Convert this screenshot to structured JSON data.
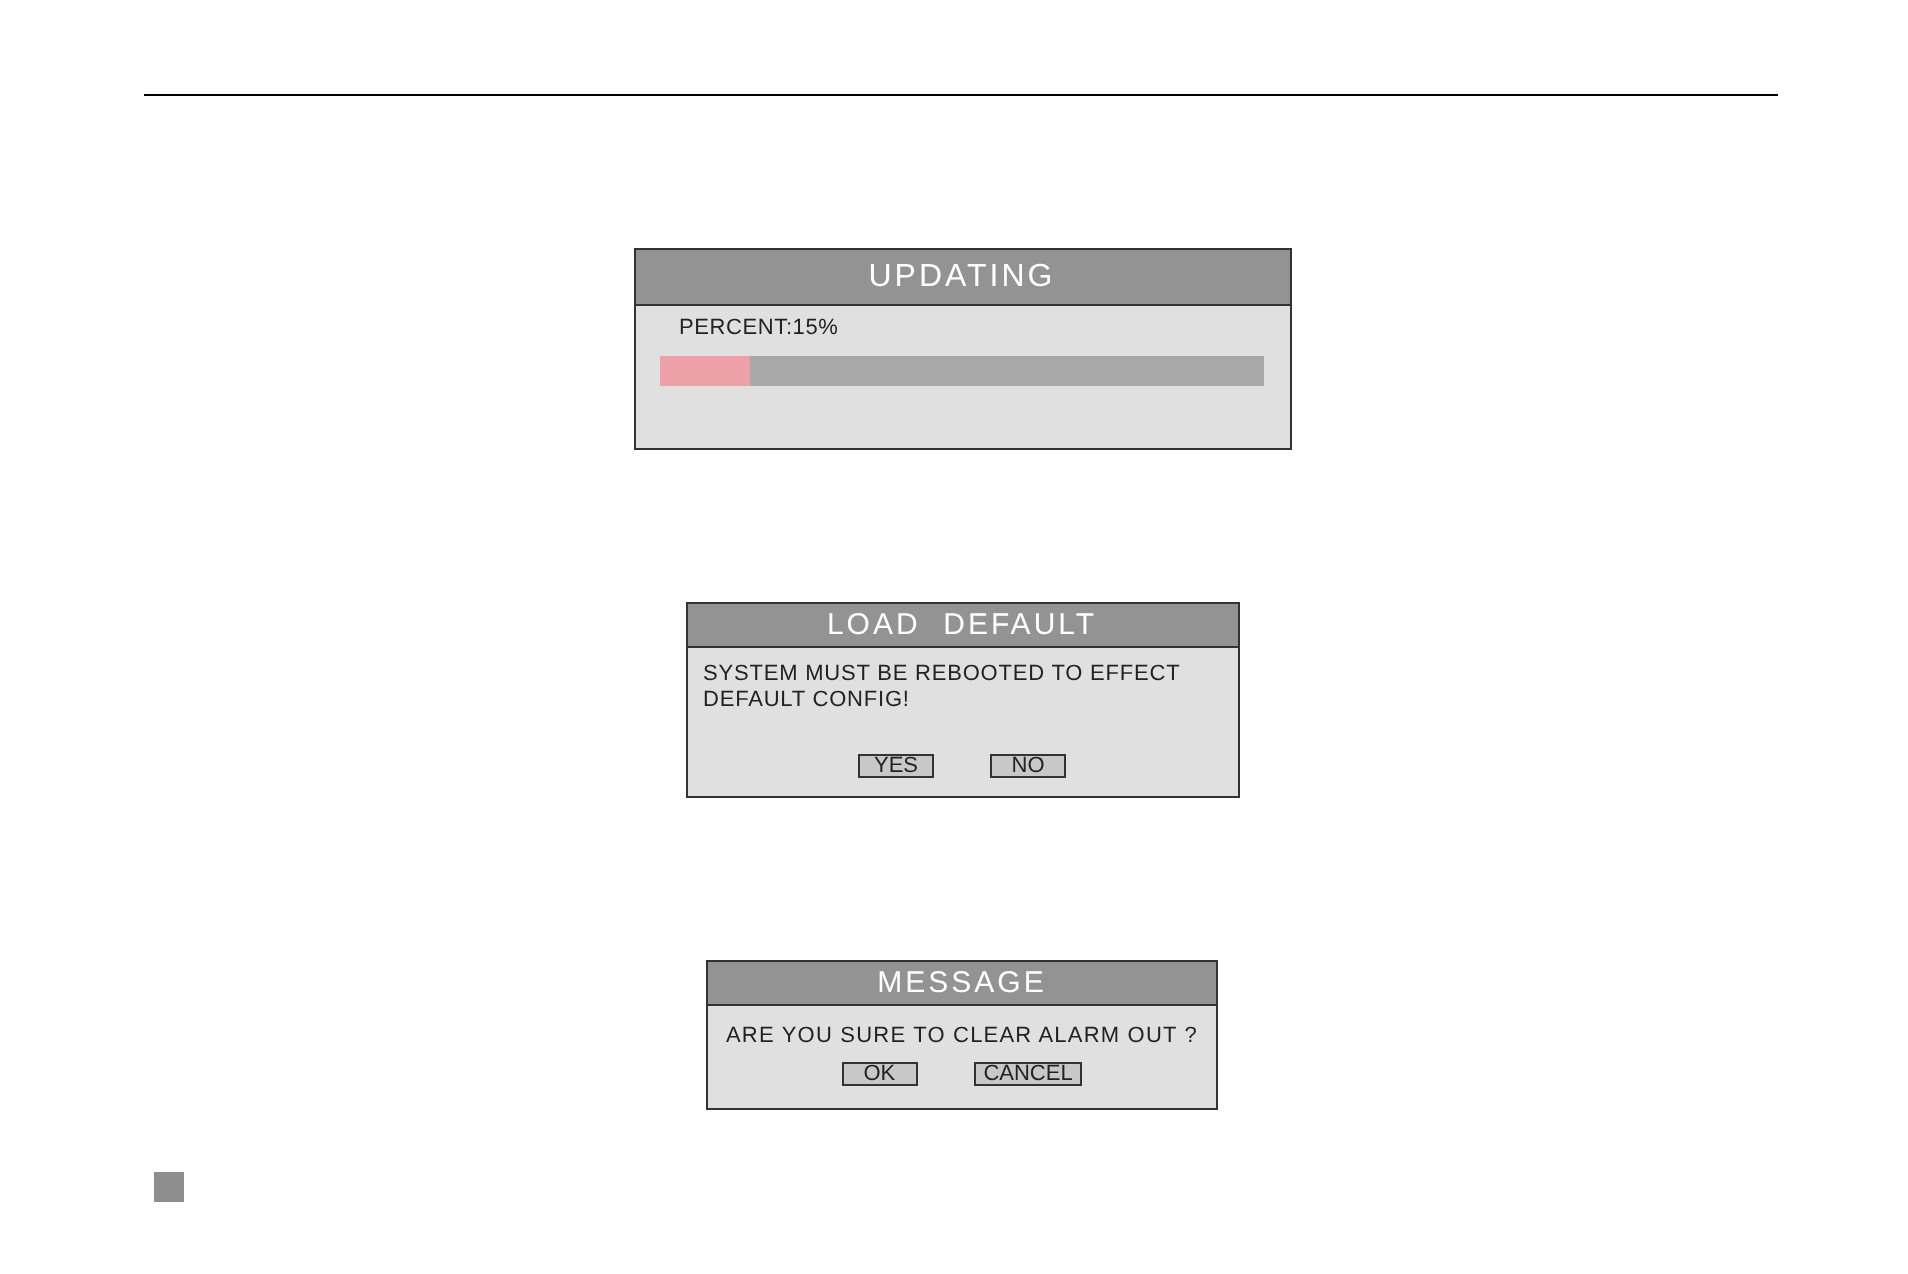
{
  "dialogs": [
    {
      "kind": "progress",
      "title": "UPDATING",
      "label": "PERCENT:15%",
      "level": 0.15
    },
    {
      "kind": "confirm",
      "title": "LOAD  DEFAULT",
      "message": "SYSTEM MUST BE REBOOTED TO EFFECT DEFAULT CONFIG!",
      "buttons": [
        "YES",
        "NO"
      ]
    },
    {
      "kind": "confirm",
      "title": "MESSAGE",
      "message": "ARE YOU SURE TO CLEAR ALARM OUT ?",
      "buttons": [
        "OK",
        "CANCEL"
      ]
    }
  ]
}
